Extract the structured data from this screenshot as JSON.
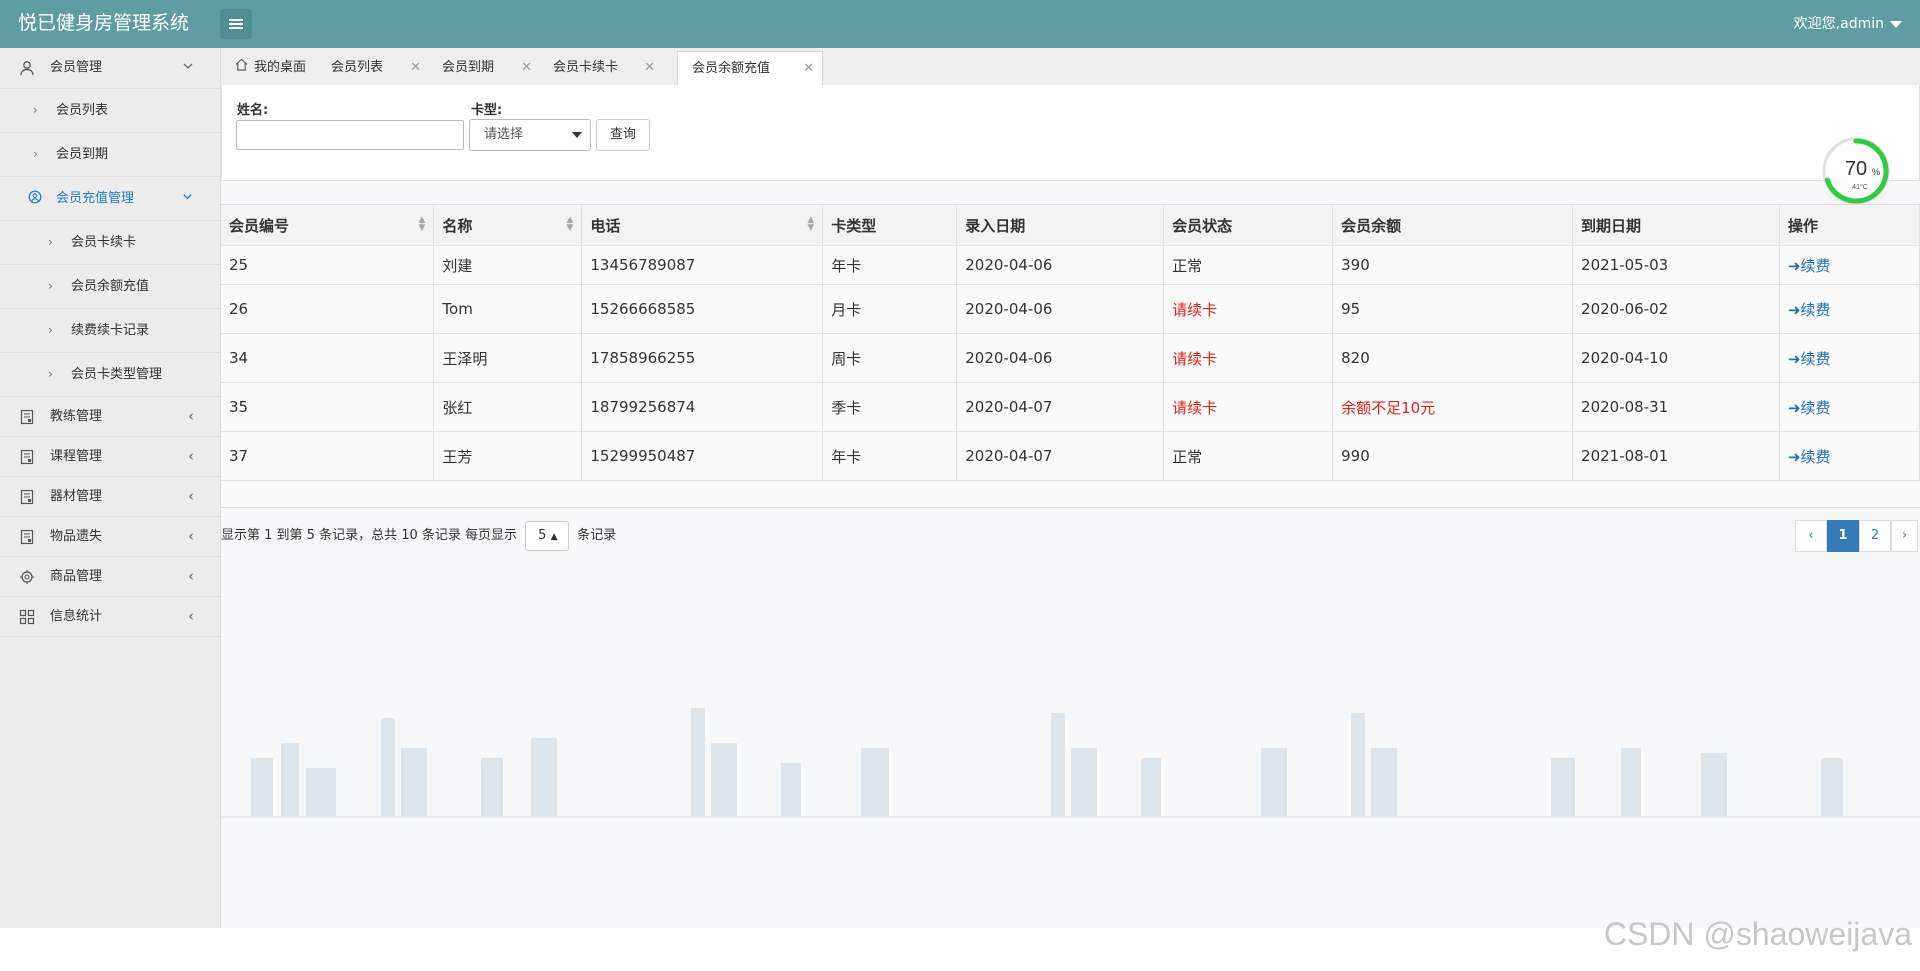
{
  "header": {
    "app_title": "悦已健身房管理系统",
    "user_label": "欢迎您,admin"
  },
  "sidebar": {
    "items": [
      {
        "label": "会员管理",
        "icon": "user-icon"
      },
      {
        "label": "会员列表"
      },
      {
        "label": "会员到期"
      },
      {
        "label": "会员充值管理",
        "icon": "circle-user-icon"
      },
      {
        "label": "会员卡续卡"
      },
      {
        "label": "会员余额充值"
      },
      {
        "label": "续费续卡记录"
      },
      {
        "label": "会员卡类型管理"
      },
      {
        "label": "教练管理",
        "icon": "document-icon"
      },
      {
        "label": "课程管理",
        "icon": "document-icon"
      },
      {
        "label": "器材管理",
        "icon": "document-icon"
      },
      {
        "label": "物品遗失",
        "icon": "document-icon"
      },
      {
        "label": "商品管理",
        "icon": "gear-icon"
      },
      {
        "label": "信息统计",
        "icon": "grid-icon"
      }
    ]
  },
  "tabs": [
    {
      "label": "我的桌面"
    },
    {
      "label": "会员列表"
    },
    {
      "label": "会员到期"
    },
    {
      "label": "会员卡续卡"
    },
    {
      "label": "会员余额充值"
    }
  ],
  "search": {
    "name_label": "姓名:",
    "name_value": "",
    "card_label": "卡型:",
    "card_placeholder": "请选择",
    "query_button": "查询"
  },
  "gauge": {
    "value": "70",
    "unit": "%",
    "temp": "41°C",
    "fraction": 0.7,
    "color": "#2ecc40"
  },
  "table": {
    "columns": [
      "会员编号",
      "名称",
      "电话",
      "卡类型",
      "录入日期",
      "会员状态",
      "会员余额",
      "到期日期",
      "操作"
    ],
    "rows": [
      [
        "25",
        "刘建",
        "13456789087",
        "年卡",
        "2020-04-06",
        "正常",
        "390",
        "2021-05-03",
        "续费"
      ],
      [
        "26",
        "Tom",
        "15266668585",
        "月卡",
        "2020-04-06",
        "请续卡",
        "95",
        "2020-06-02",
        "续费"
      ],
      [
        "34",
        "王泽明",
        "17858966255",
        "周卡",
        "2020-04-06",
        "请续卡",
        "820",
        "2020-04-10",
        "续费"
      ],
      [
        "35",
        "张红",
        "18799256874",
        "季卡",
        "2020-04-07",
        "请续卡",
        "余额不足10元",
        "2020-08-31",
        "续费"
      ],
      [
        "37",
        "王芳",
        "15299950487",
        "年卡",
        "2020-04-07",
        "正常",
        "990",
        "2021-08-01",
        "续费"
      ]
    ]
  },
  "pagination": {
    "info_prefix": "显示第 1 到第 5 条记录，总共 10 条记录 每页显示",
    "page_size": "5",
    "info_suffix": "条记录",
    "prev": "‹",
    "pages": [
      "1",
      "2"
    ],
    "next": "›",
    "active_color": "#337ab7"
  },
  "watermark": "CSDN @shaoweijava",
  "colors": {
    "header": "#5f9ea0",
    "accent": "#1f7bd1",
    "warning": "#e4231a"
  }
}
